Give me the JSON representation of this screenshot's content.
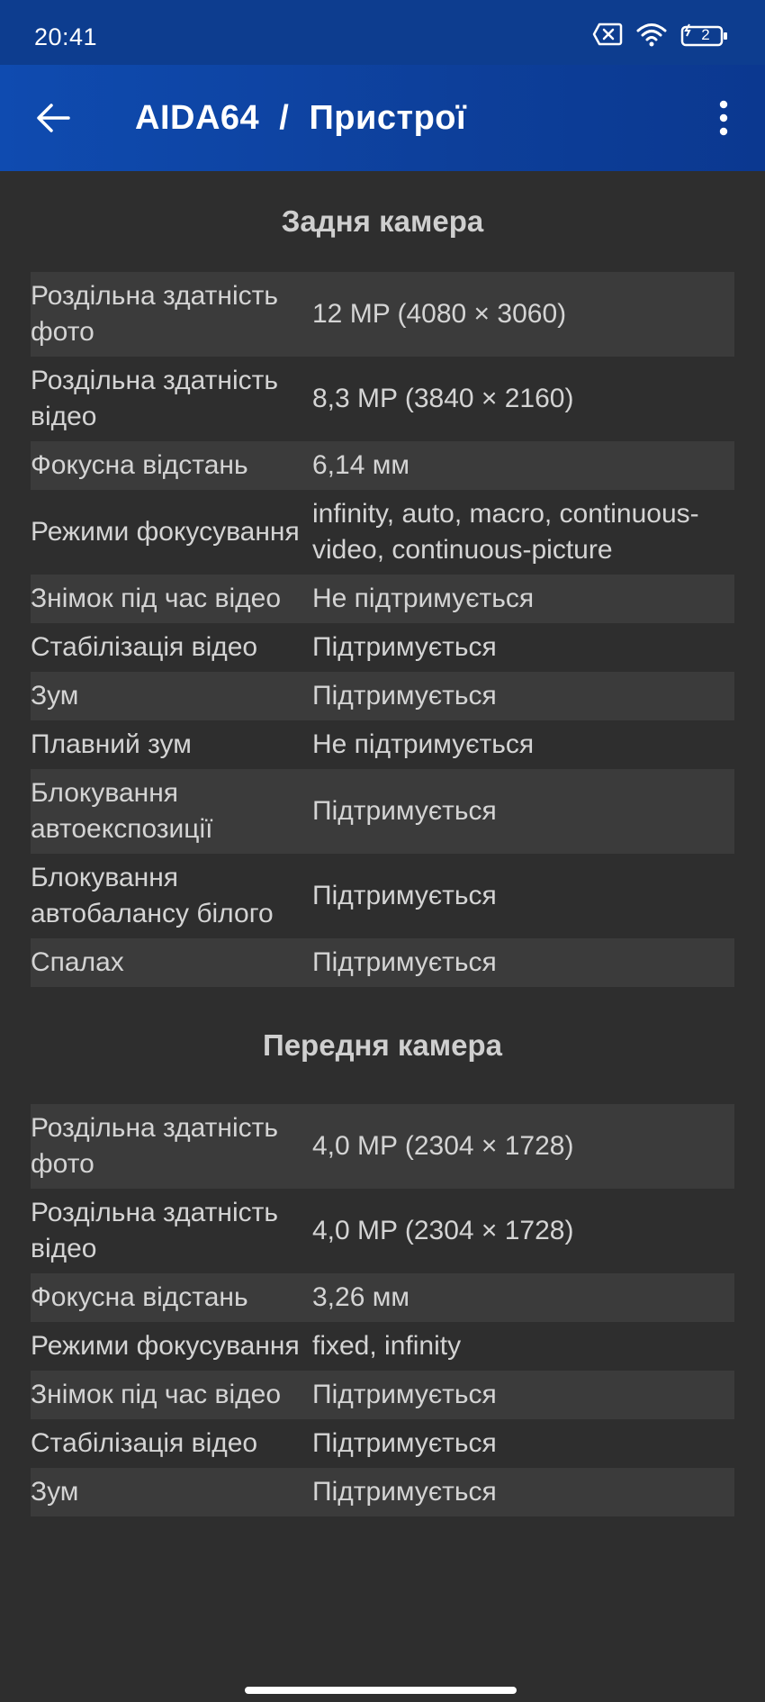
{
  "status_bar": {
    "time": "20:41",
    "battery_level": "2"
  },
  "app_bar": {
    "title": "AIDA64  /  Пристрої"
  },
  "sections": [
    {
      "title": "Задня камера",
      "rows": [
        {
          "label": "Роздільна здатність фото",
          "value": "12 MP (4080 × 3060)"
        },
        {
          "label": "Роздільна здатність відео",
          "value": "8,3 MP (3840 × 2160)"
        },
        {
          "label": "Фокусна відстань",
          "value": "6,14 мм"
        },
        {
          "label": "Режими фокусування",
          "value": "infinity, auto, macro, continuous-video, continuous-picture"
        },
        {
          "label": "Знімок під час відео",
          "value": "Не підтримується"
        },
        {
          "label": "Стабілізація відео",
          "value": "Підтримується"
        },
        {
          "label": "Зум",
          "value": "Підтримується"
        },
        {
          "label": "Плавний зум",
          "value": "Не підтримується"
        },
        {
          "label": "Блокування автоекспозиції",
          "value": "Підтримується"
        },
        {
          "label": "Блокування автобалансу білого",
          "value": "Підтримується"
        },
        {
          "label": "Спалах",
          "value": "Підтримується"
        }
      ]
    },
    {
      "title": "Передня камера",
      "rows": [
        {
          "label": "Роздільна здатність фото",
          "value": "4,0 MP (2304 × 1728)"
        },
        {
          "label": "Роздільна здатність відео",
          "value": "4,0 MP (2304 × 1728)"
        },
        {
          "label": "Фокусна відстань",
          "value": "3,26 мм"
        },
        {
          "label": "Режими фокусування",
          "value": "fixed, infinity"
        },
        {
          "label": "Знімок під час відео",
          "value": "Підтримується"
        },
        {
          "label": "Стабілізація відео",
          "value": "Підтримується"
        },
        {
          "label": "Зум",
          "value": "Підтримується"
        }
      ]
    }
  ]
}
